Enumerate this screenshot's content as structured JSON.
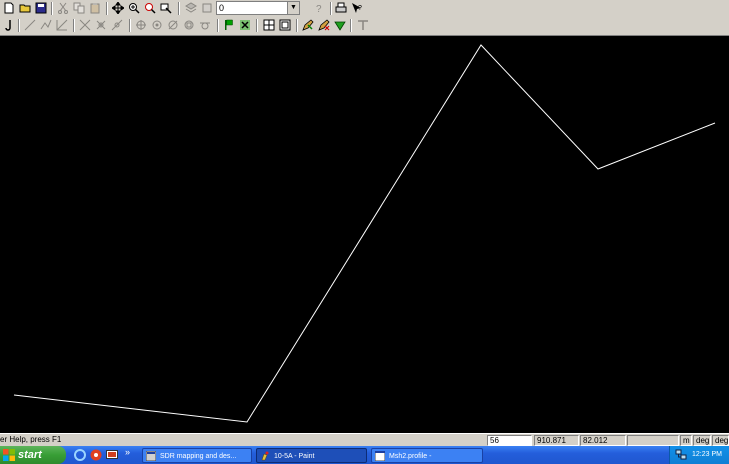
{
  "toolbar1": {
    "layer_value": "0",
    "icons": [
      "new-icon",
      "open-icon",
      "save-icon",
      "cut-icon",
      "copy-icon",
      "paste-icon",
      "pan-icon",
      "zoom-in-icon",
      "zoom-window-icon",
      "zoom-previous-icon",
      "layer-icon",
      "layer-props-icon",
      "help-icon",
      "print-icon",
      "whats-this-icon"
    ]
  },
  "toolbar2": {
    "icons": [
      "draw-icon",
      "line-icon",
      "polyline-icon",
      "arc-icon",
      "circle-icon",
      "rectangle-icon",
      "snap-icon",
      "snap-end-icon",
      "snap-mid-icon",
      "snap-center-icon",
      "snap-node-icon",
      "flag-icon",
      "delete-point-icon",
      "grid-icon",
      "ortho-icon",
      "pencil-check-icon",
      "pencil-cross-icon",
      "checkmark-icon",
      "text-icon"
    ]
  },
  "canvas": {
    "background": "#000000",
    "line_color": "#ffffff"
  },
  "statusbar": {
    "help_text": "er Help, press F1",
    "field1": "56",
    "coord_x": "910.871",
    "coord_y": "82.012",
    "unit1": "m",
    "unit2": "deg",
    "unit3": "deg"
  },
  "taskbar": {
    "start_label": "start",
    "tasks": [
      {
        "label": "SDR mapping and des...",
        "active": false
      },
      {
        "label": "10-5A - Paint",
        "active": true
      },
      {
        "label": "Msh2.profile -",
        "active": false
      }
    ],
    "clock": "12:23 PM",
    "overflow_label": "»"
  }
}
